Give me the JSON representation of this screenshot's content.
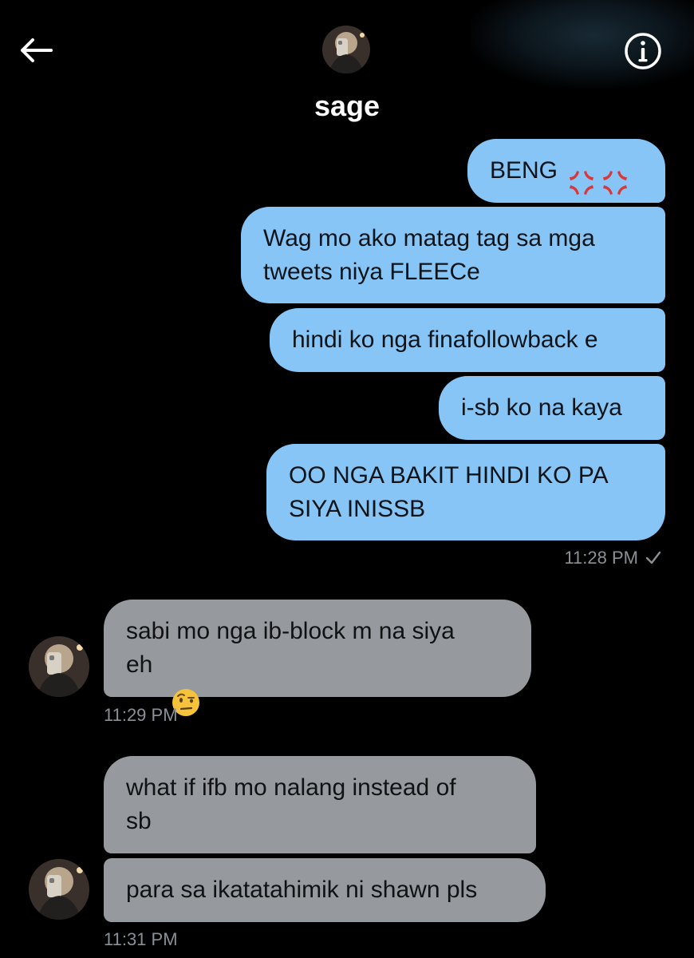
{
  "header": {
    "title": "sage",
    "back_icon": "arrow-left-icon",
    "info_icon": "info-circle-icon"
  },
  "messages_out": [
    {
      "text": "BENG",
      "emoji": "anger-symbol-icon ×2"
    },
    {
      "text": "Wag mo ako matag tag sa mga\ntweets niya FLEECe"
    },
    {
      "text": "hindi ko nga finafollowback e"
    },
    {
      "text": "i-sb ko na kaya"
    },
    {
      "text": "OO NGA BAKIT HINDI KO PA\nSIYA INISSB"
    }
  ],
  "timestamp_out": "11:28 PM",
  "read_receipt_icon": "checkmark-icon",
  "messages_in": [
    {
      "text": "sabi mo nga ib-block m na siya\neh",
      "emoji": "face-with-raised-eyebrow-icon"
    },
    {
      "text": "what if ifb mo nalang instead of\nsb"
    },
    {
      "text": "para sa ikatatahimik ni shawn pls"
    }
  ],
  "timestamps_in": [
    "11:29 PM",
    "11:31 PM"
  ],
  "colors": {
    "background": "#000000",
    "outgoing_bubble": "#86c5f5",
    "incoming_bubble": "#96999d",
    "timestamp": "#8b9096"
  }
}
